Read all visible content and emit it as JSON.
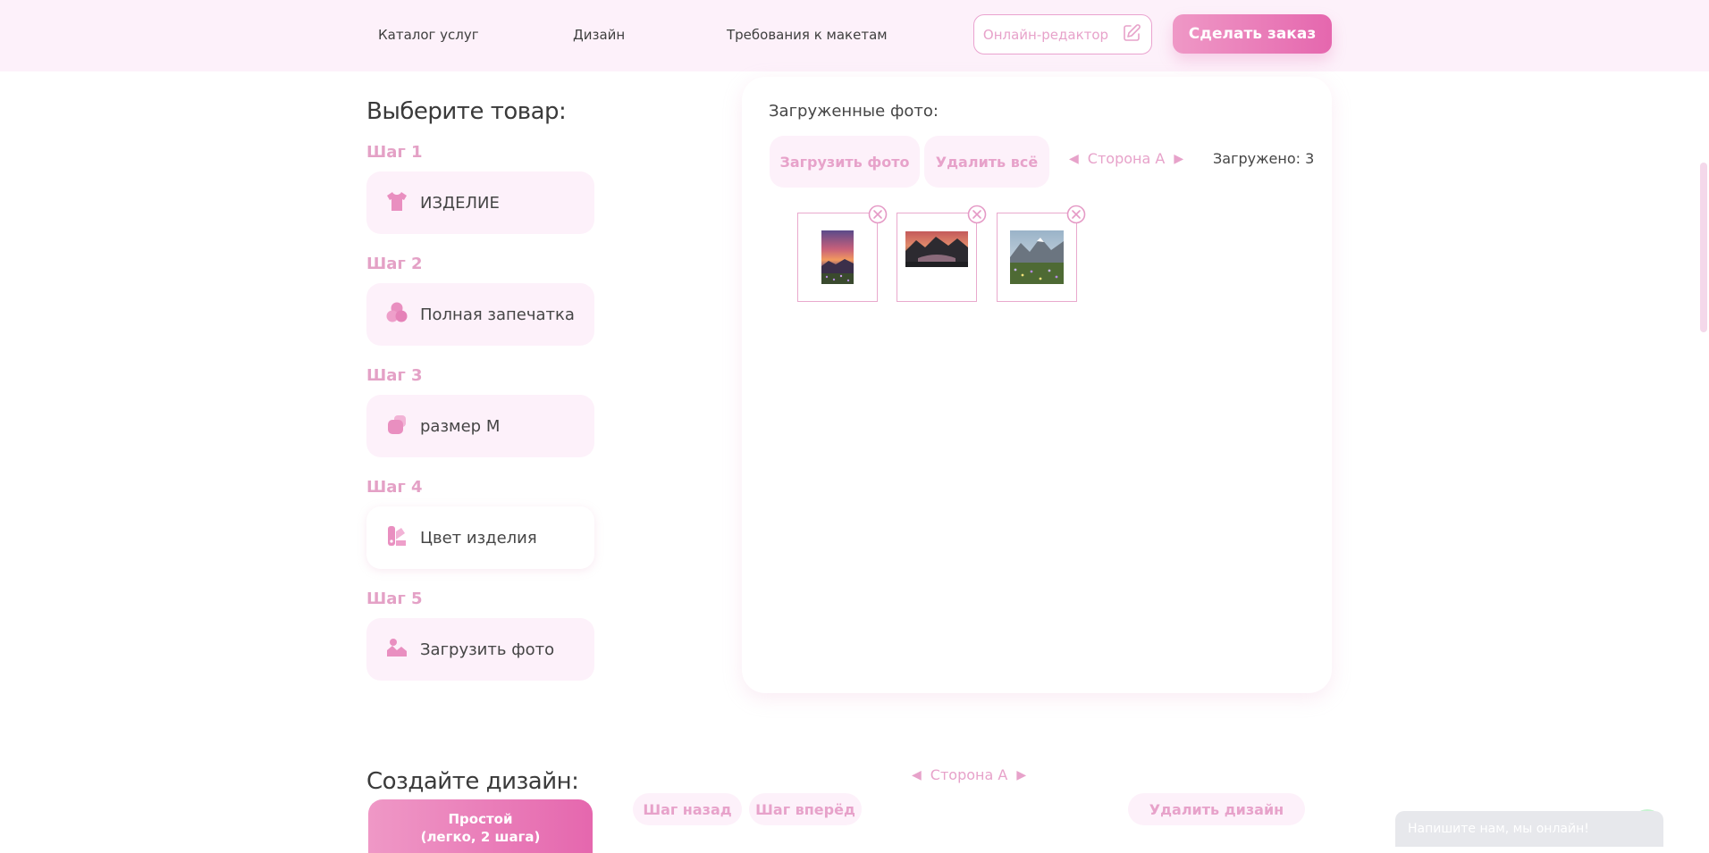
{
  "header": {
    "nav": [
      "Каталог услуг",
      "Дизайн",
      "Требования к макетам"
    ],
    "editor_label": "Онлайн-редактор",
    "editor_icon": "edit-icon",
    "order_label": "Сделать заказ"
  },
  "left": {
    "title": "Выберите товар:",
    "steps": [
      {
        "label": "Шаг 1",
        "value": "ИЗДЕЛИЕ",
        "icon": "tshirt-icon"
      },
      {
        "label": "Шаг 2",
        "value": "Полная запечатка",
        "icon": "circles-icon"
      },
      {
        "label": "Шаг 3",
        "value": "размер  M",
        "icon": "size-icon"
      },
      {
        "label": "Шаг 4",
        "value": "Цвет изделия",
        "icon": "palette-icon"
      },
      {
        "label": "Шаг 5",
        "value": "Загрузить фото",
        "icon": "image-icon"
      }
    ]
  },
  "panel": {
    "title": "Загруженные фото:",
    "upload_label": "Загрузить фото",
    "delete_all_label": "Удалить всё",
    "side_label": "Сторона А",
    "uploaded_count": "Загружено: 3",
    "photos": [
      {
        "name": "Sunset meadow (portrait)",
        "icon": "photo-thumbnail"
      },
      {
        "name": "Mountain lake at dusk",
        "icon": "photo-thumbnail"
      },
      {
        "name": "Alpine flower field",
        "icon": "photo-thumbnail"
      }
    ]
  },
  "design": {
    "title": "Создайте дизайн:",
    "simple_label": "Простой",
    "simple_sub": "(легко, 2 шага)",
    "side_label": "Сторона А",
    "step_back": "Шаг назад",
    "step_forward": "Шаг вперёд",
    "delete_design": "Удалить дизайн"
  },
  "chat": {
    "label": "Напишите нам, мы онлайн!"
  },
  "colors": {
    "accent": "#e567ae",
    "accent_light": "#ef98c6",
    "pink_bg": "#fdf1fa",
    "pink_text": "#e7a2ca",
    "step_label": "#e4a1c6"
  }
}
